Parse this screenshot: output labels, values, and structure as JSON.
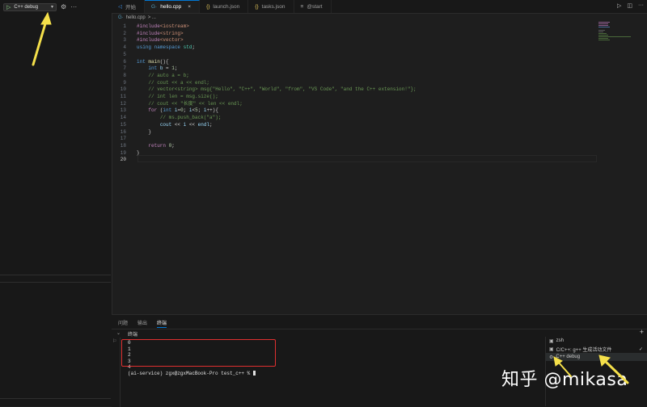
{
  "sidebar": {
    "debug_config": "C++ debug",
    "chevron": "▾",
    "play_icon": "▷",
    "gear_icon": "⚙",
    "more_icon": "···"
  },
  "tabs": [
    {
      "label": "开始",
      "icon": "◁",
      "icon_color": "#3c8ee5"
    },
    {
      "label": "hello.cpp",
      "icon": "G·",
      "icon_color": "#519aba",
      "active": true
    },
    {
      "label": "launch.json",
      "icon": "{}",
      "icon_color": "#e6c85c"
    },
    {
      "label": "tasks.json",
      "icon": "{}",
      "icon_color": "#e6c85c"
    },
    {
      "label": "@start",
      "icon": "≡",
      "icon_color": "#a0a0a0"
    }
  ],
  "tab_close": "×",
  "breadcrumb": {
    "icon": "G·",
    "file": "hello.cpp",
    "sep": "> ..."
  },
  "code": [
    "#include<iostream>",
    "#include<string>",
    "#include<vector>",
    "using namespace std;",
    "",
    "int main(){",
    "    int b = 1;",
    "    // auto a = b;",
    "    // cout << a << endl;",
    "    // vector<string> msg{\"Hello\", \"C++\", \"World\", \"from\", \"VS Code\", \"and the C++ extension!\"};",
    "    // int len = msg.size();",
    "    // cout << \"长度\" << len << endl;",
    "    for (int i=0; i<5; i++){",
    "        // ms.push_back(\"a\");",
    "        cout << i << endl;",
    "    }",
    "",
    "    return 0;",
    "}",
    ""
  ],
  "panel": {
    "tabs": [
      "问题",
      "输出",
      "终端"
    ],
    "terminal_title": "终端",
    "output_lines": [
      "0",
      "1",
      "2",
      "3",
      "4"
    ],
    "prompt": "(ai-service) zgx@zgxMacBook-Pro test_c++ % ",
    "add_icon": "+"
  },
  "terminals": [
    {
      "label": "zsh",
      "icon": "▣"
    },
    {
      "label": "C/C++: g++ 生成活动文件",
      "icon": "▣",
      "check": "✓"
    },
    {
      "label": "C++ debug",
      "icon": "⚙"
    }
  ],
  "watermark": "知乎 @mikasa",
  "colors": {
    "accent": "#0078d4",
    "annotation_arrow": "#f5e04a",
    "highlight_box": "#e03030"
  }
}
